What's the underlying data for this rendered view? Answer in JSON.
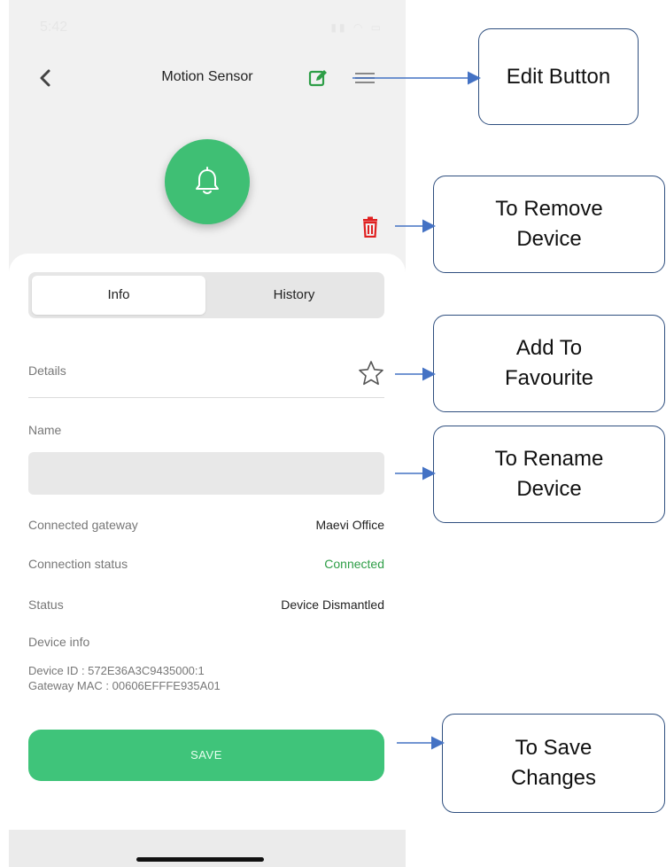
{
  "status_bar": {
    "time": "5:42",
    "icons": "signal wifi battery"
  },
  "header": {
    "title": "Motion Sensor"
  },
  "tabs": [
    {
      "label": "Info"
    },
    {
      "label": "History"
    }
  ],
  "details": {
    "label": "Details"
  },
  "name": {
    "label": "Name",
    "value": ""
  },
  "rows": [
    {
      "label": "Connected gateway",
      "value": "Maevi Office"
    },
    {
      "label": "Connection status",
      "value": "Connected"
    },
    {
      "label": "Status",
      "value": "Device Dismantled"
    }
  ],
  "device_info": {
    "label": "Device info",
    "device_id": "Device ID : 572E36A3C9435000:1",
    "gateway_mac": "Gateway MAC : 00606EFFFE935A01"
  },
  "save_label": "SAVE",
  "callouts": {
    "edit": "Edit Button",
    "remove_line1": "To Remove",
    "remove_line2": "Device",
    "favourite_line1": "Add To",
    "favourite_line2": "Favourite",
    "rename_line1": "To Rename",
    "rename_line2": "Device",
    "save_line1": "To Save",
    "save_line2": "Changes"
  },
  "colors": {
    "accent_green": "#3fc47a",
    "connected_green": "#2e9e47",
    "delete_red": "#e02020",
    "edit_green": "#2e9e47",
    "callout_border": "#2f4f7f",
    "arrow_blue": "#4472c4"
  }
}
